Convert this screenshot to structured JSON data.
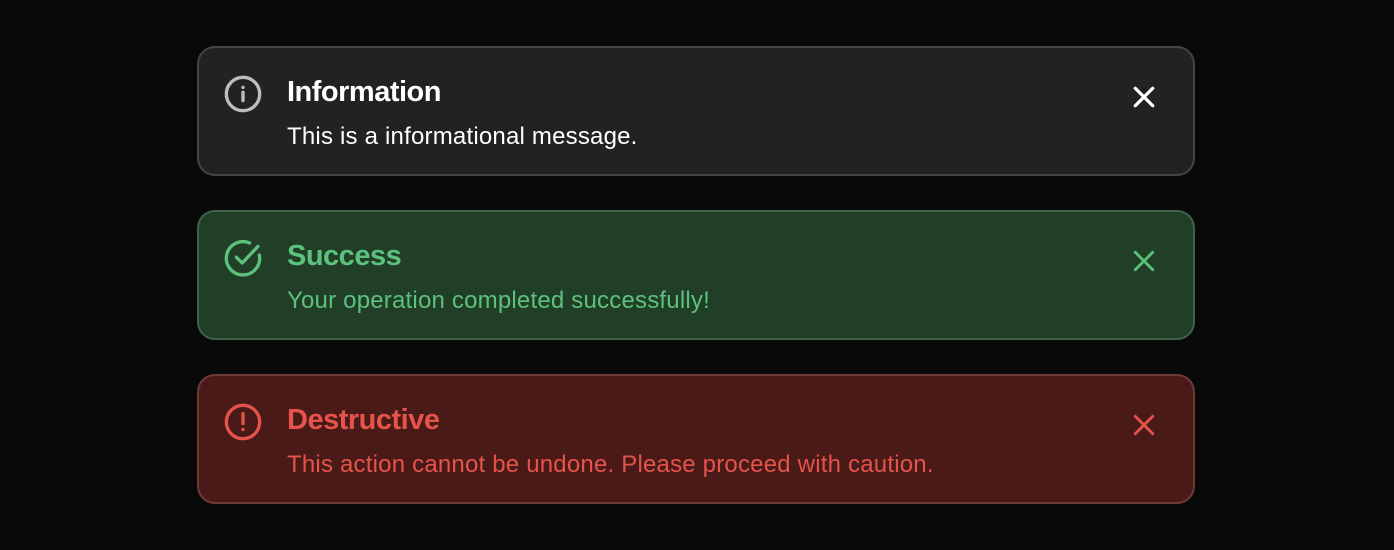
{
  "alerts": [
    {
      "variant": "info",
      "icon": "info-circle-icon",
      "title": "Information",
      "description": "This is a informational message.",
      "accent": "#ffffff",
      "background": "#222222"
    },
    {
      "variant": "success",
      "icon": "check-circle-icon",
      "title": "Success",
      "description": "Your operation completed successfully!",
      "accent": "#5cc17d",
      "background": "#213f27"
    },
    {
      "variant": "destructive",
      "icon": "alert-circle-icon",
      "title": "Destructive",
      "description": "This action cannot be undone. Please proceed with caution.",
      "accent": "#e5534b",
      "background": "#4a1a18"
    }
  ],
  "close_icon": "close-icon"
}
